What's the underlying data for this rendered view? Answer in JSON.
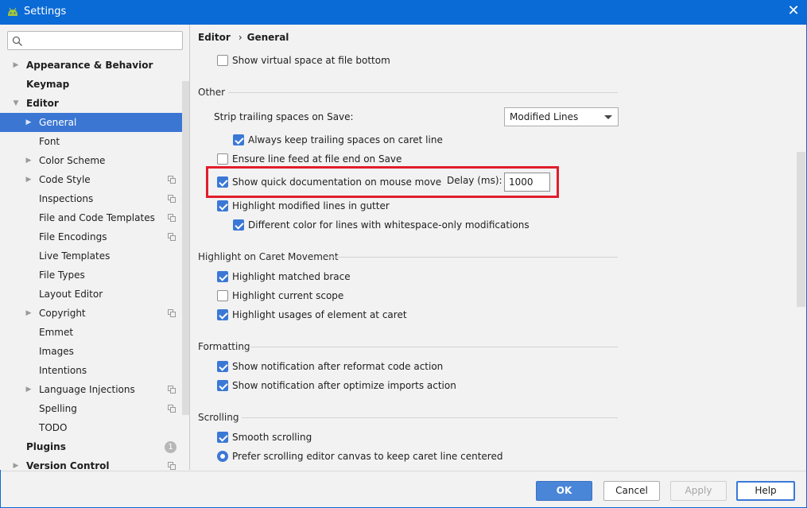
{
  "window": {
    "title": "Settings",
    "icon": "android-robot-icon",
    "accent": "#0a6ad6"
  },
  "search": {
    "placeholder": "",
    "value": ""
  },
  "tree": [
    {
      "label": "Appearance & Behavior",
      "bold": true,
      "level": 0,
      "arrow": "▶"
    },
    {
      "label": "Keymap",
      "bold": true,
      "level": 0,
      "arrow": ""
    },
    {
      "label": "Editor",
      "bold": true,
      "level": 0,
      "arrow": "▼"
    },
    {
      "label": "General",
      "bold": false,
      "level": 1,
      "arrow": "▶",
      "selected": true
    },
    {
      "label": "Font",
      "bold": false,
      "level": 1,
      "arrow": ""
    },
    {
      "label": "Color Scheme",
      "bold": false,
      "level": 1,
      "arrow": "▶"
    },
    {
      "label": "Code Style",
      "bold": false,
      "level": 1,
      "arrow": "▶",
      "project": true
    },
    {
      "label": "Inspections",
      "bold": false,
      "level": 1,
      "arrow": "",
      "project": true
    },
    {
      "label": "File and Code Templates",
      "bold": false,
      "level": 1,
      "arrow": "",
      "project": true
    },
    {
      "label": "File Encodings",
      "bold": false,
      "level": 1,
      "arrow": "",
      "project": true
    },
    {
      "label": "Live Templates",
      "bold": false,
      "level": 1,
      "arrow": ""
    },
    {
      "label": "File Types",
      "bold": false,
      "level": 1,
      "arrow": ""
    },
    {
      "label": "Layout Editor",
      "bold": false,
      "level": 1,
      "arrow": ""
    },
    {
      "label": "Copyright",
      "bold": false,
      "level": 1,
      "arrow": "▶",
      "project": true
    },
    {
      "label": "Emmet",
      "bold": false,
      "level": 1,
      "arrow": ""
    },
    {
      "label": "Images",
      "bold": false,
      "level": 1,
      "arrow": ""
    },
    {
      "label": "Intentions",
      "bold": false,
      "level": 1,
      "arrow": ""
    },
    {
      "label": "Language Injections",
      "bold": false,
      "level": 1,
      "arrow": "▶",
      "project": true
    },
    {
      "label": "Spelling",
      "bold": false,
      "level": 1,
      "arrow": "",
      "project": true
    },
    {
      "label": "TODO",
      "bold": false,
      "level": 1,
      "arrow": ""
    },
    {
      "label": "Plugins",
      "bold": true,
      "level": 0,
      "arrow": "",
      "badge": "1"
    },
    {
      "label": "Version Control",
      "bold": true,
      "level": 0,
      "arrow": "▶",
      "project": true
    }
  ],
  "breadcrumb": {
    "parent": "Editor",
    "separator": "›",
    "current": "General"
  },
  "content": {
    "virtual_space": {
      "label": "Show virtual space at file bottom",
      "checked": false
    },
    "other": {
      "heading": "Other",
      "strip_label": "Strip trailing spaces on Save:",
      "strip_value": "Modified Lines",
      "keep_trailing": {
        "label": "Always keep trailing spaces on caret line",
        "checked": true
      },
      "line_feed": {
        "label": "Ensure line feed at file end on Save",
        "checked": false
      },
      "quick_doc": {
        "label": "Show quick documentation on mouse move",
        "checked": true
      },
      "delay_label": "Delay (ms):",
      "delay_value": "1000",
      "highlight_modified": {
        "label": "Highlight modified lines in gutter",
        "checked": true
      },
      "diff_color": {
        "label": "Different color for lines with whitespace-only modifications",
        "checked": true
      }
    },
    "caret": {
      "heading": "Highlight on Caret Movement",
      "matched_brace": {
        "label": "Highlight matched brace",
        "checked": true
      },
      "current_scope": {
        "label": "Highlight current scope",
        "checked": false
      },
      "usages": {
        "label": "Highlight usages of element at caret",
        "checked": true
      }
    },
    "formatting": {
      "heading": "Formatting",
      "reformat": {
        "label": "Show notification after reformat code action",
        "checked": true
      },
      "optimize": {
        "label": "Show notification after optimize imports action",
        "checked": true
      }
    },
    "scrolling": {
      "heading": "Scrolling",
      "smooth": {
        "label": "Smooth scrolling",
        "checked": true
      },
      "prefer": {
        "label": "Prefer scrolling editor canvas to keep caret line centered",
        "selected": true
      }
    }
  },
  "buttons": {
    "ok": "OK",
    "cancel": "Cancel",
    "apply": "Apply",
    "help": "Help"
  },
  "colors": {
    "selection": "#3b76d3",
    "checkbox": "#3b78d6",
    "highlight_box": "#e11e2b"
  }
}
